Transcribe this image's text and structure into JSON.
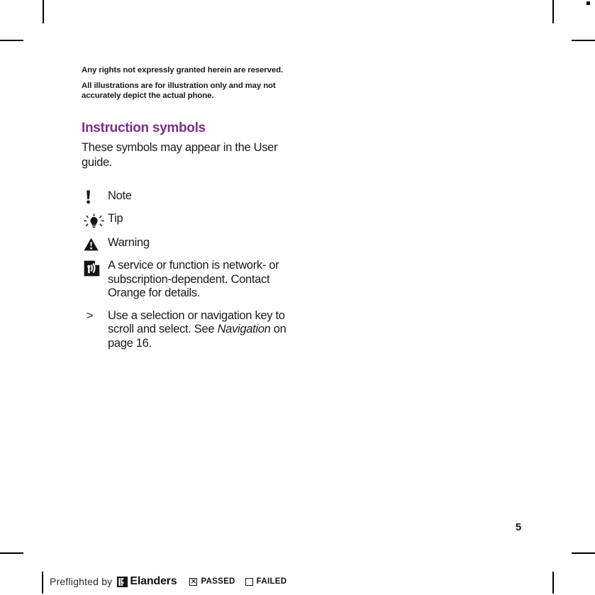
{
  "document": {
    "page_number": "5",
    "heading_color": "#7d2e8d",
    "intro": {
      "lead": "Any rights not expressly granted herein are reserved.",
      "body": "All illustrations are for illustration only and may not accurately depict the actual phone."
    },
    "section": {
      "heading": "Instruction symbols",
      "intro": "These symbols may appear in the User guide."
    },
    "legend": [
      {
        "icon": "exclamation-mark-icon",
        "text": "Note"
      },
      {
        "icon": "lightbulb-icon",
        "text": "Tip"
      },
      {
        "icon": "warning-triangle-icon",
        "text": "Warning"
      },
      {
        "icon": "network-service-icon",
        "text": "A service or function is network- or subscription-dependent. Contact Orange for details."
      },
      {
        "icon": "greater-than-symbol",
        "symbol": ">",
        "text_before": "Use a selection or navigation key to scroll and select. See ",
        "text_italic": "Navigation",
        "text_after": " on page 16."
      }
    ]
  },
  "footer": {
    "preflight_label": "Preflighted by",
    "brand_name": "Elanders",
    "passed_label": "PASSED",
    "failed_label": "FAILED",
    "passed_checked": true,
    "failed_checked": false
  }
}
